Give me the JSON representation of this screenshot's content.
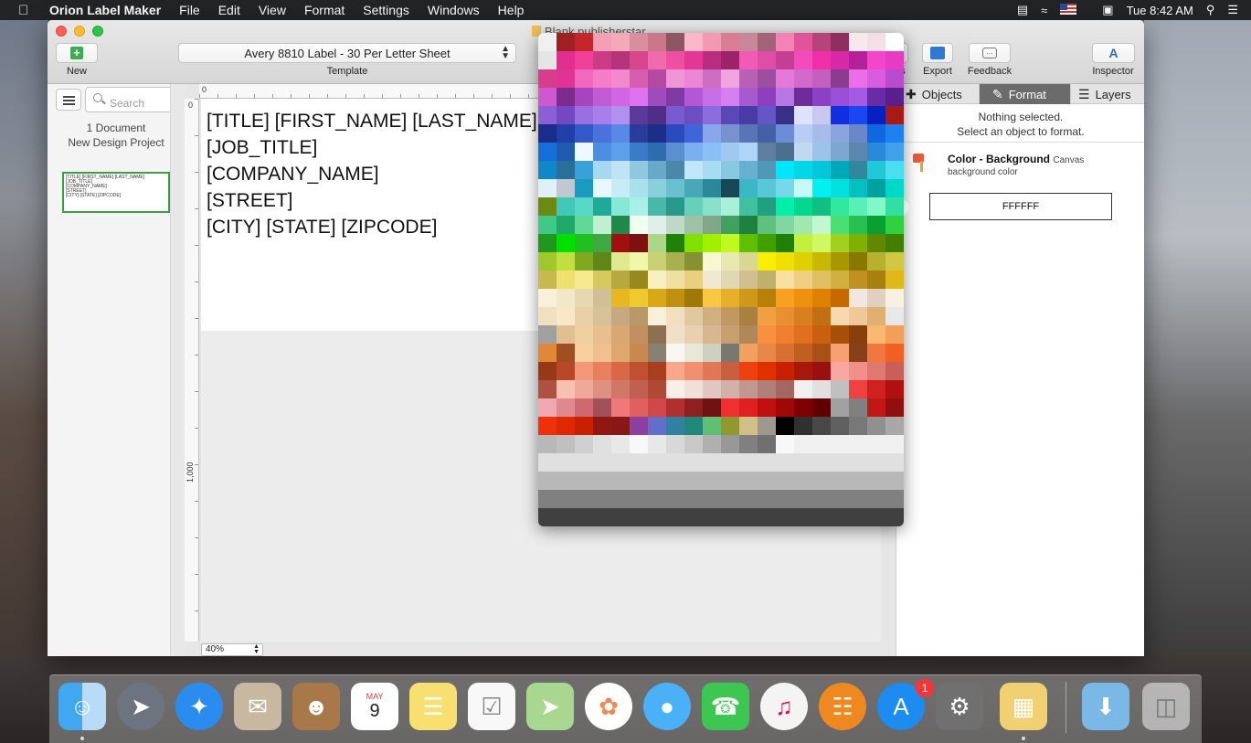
{
  "menubar": {
    "app_name": "Orion Label Maker",
    "items": [
      "File",
      "Edit",
      "View",
      "Format",
      "Settings",
      "Windows",
      "Help"
    ],
    "clock": "Tue 8:42 AM"
  },
  "window": {
    "title": "Blank.publisherstar"
  },
  "toolbar": {
    "new_label": "New",
    "template_value": "Avery 8810 Label - 30 Per Letter Sheet",
    "template_label": "Template",
    "partial_label": "s",
    "export_label": "Export",
    "feedback_label": "Feedback",
    "inspector_label": "Inspector"
  },
  "sidebar": {
    "search_placeholder": "Search",
    "doc_count": "1 Document",
    "project_name": "New Design Project",
    "thumb_lines": [
      "[TITLE] [FIRST_NAME] [LAST_NAME]",
      "[JOB_TITLE]",
      "[COMPANY_NAME]",
      "[STREET]",
      "[CITY] [STATE] [ZIPCODE]"
    ]
  },
  "canvas": {
    "ruler_h_zero": "0",
    "ruler_v_zero": "0",
    "ruler_v_1000": "1,000",
    "zoom": "40%",
    "lines": [
      "[TITLE] [FIRST_NAME] [LAST_NAME]",
      "[JOB_TITLE]",
      "[COMPANY_NAME]",
      "[STREET]",
      "[CITY] [STATE] [ZIPCODE]"
    ]
  },
  "inspector": {
    "tabs": [
      "Objects",
      "Format",
      "Layers"
    ],
    "active_tab": "Format",
    "no_selection_1": "Nothing selected.",
    "no_selection_2": "Select an object to format.",
    "color_title": "Color - Background",
    "color_scope": "Canvas",
    "color_desc": "background color",
    "hex_value": "FFFFFF"
  },
  "dock": {
    "calendar_month": "MAY",
    "calendar_day": "9",
    "appstore_badge": "1",
    "icons": [
      "finder-icon",
      "launchpad-icon",
      "safari-icon",
      "mail-icon",
      "contacts-icon",
      "calendar-icon",
      "notes-icon",
      "reminders-icon",
      "maps-icon",
      "photos-icon",
      "messages-icon",
      "facetime-icon",
      "itunes-icon",
      "ibooks-icon",
      "app-store-icon",
      "system-preferences-icon",
      "label-maker-icon",
      "downloads-folder-icon",
      "trash-icon"
    ]
  },
  "palette": {
    "rows": [
      [
        "#f0f0f0",
        "#a01f22",
        "#c5262c",
        "#f3a0b6",
        "#f5a9b8",
        "#d98d9d",
        "#c8788a",
        "#8e5662",
        "#f9b7c8",
        "#f29ab1",
        "#d97d96",
        "#c7889a",
        "#a36278",
        "#f582b4",
        "#e0559a",
        "#b54479",
        "#8f2e5f",
        "#f5e9ee",
        "#f2e0e6",
        "#fff"
      ],
      [
        "#e5e5e5",
        "#e22e8e",
        "#f0409a",
        "#cc3b88",
        "#b5357a",
        "#d6478d",
        "#f06aac",
        "#f04fa1",
        "#e23797",
        "#b92d7e",
        "#9c2269",
        "#f25bb3",
        "#de4ea8",
        "#c53e93",
        "#f34bba",
        "#f02fa8",
        "#d728a8",
        "#b51f98",
        "#f346c9",
        "#e83bc4"
      ],
      [
        "#d93c8d",
        "#dd3496",
        "#f068c0",
        "#f57cc7",
        "#f389cc",
        "#d65eb1",
        "#b548a0",
        "#f096d8",
        "#ea86d3",
        "#cc6fc1",
        "#f0a4e0",
        "#b860b4",
        "#9c4ea1",
        "#e579d9",
        "#d26acb",
        "#c25fbf",
        "#8a3d8f",
        "#ea6fe7",
        "#d85ce0",
        "#b84ccd"
      ],
      [
        "#ce58cf",
        "#7b2d8e",
        "#a844c0",
        "#c25ad6",
        "#d165e4",
        "#de72f0",
        "#9d4bbd",
        "#7e3aa2",
        "#b457d7",
        "#c76de6",
        "#d77ff0",
        "#a65ad0",
        "#8e3fbf",
        "#b877e0",
        "#6e2c9a",
        "#8a42c5",
        "#9b4fd8",
        "#a35be6",
        "#6a2ca5",
        "#5a1f8f"
      ],
      [
        "#8d5fd6",
        "#7448c2",
        "#9a6fe0",
        "#a87fe8",
        "#b38ff0",
        "#5c3a9c",
        "#4f2e8a",
        "#7a5ad0",
        "#6c4dc2",
        "#8a6cdc",
        "#5b48b8",
        "#4a3aa5",
        "#6556c8",
        "#3a2f88",
        "#e0e0ff",
        "#c8c8f0",
        "#1030e0",
        "#1848f0",
        "#0820c0",
        "#a81a14"
      ],
      [
        "#1a2d8a",
        "#2040a8",
        "#3358c8",
        "#4a72dc",
        "#5a88e8",
        "#2a3c9a",
        "#1c2e88",
        "#2c4ac0",
        "#3e66d8",
        "#8aa6e8",
        "#7892d0",
        "#5a74b8",
        "#4660a8",
        "#6c8cd8",
        "#b8ccf5",
        "#a8bcea",
        "#8aa4dc",
        "#6a88c8",
        "#1068e0",
        "#2080f0"
      ],
      [
        "#1470d8",
        "#1f5cb0",
        "#f0f8ff",
        "#4c8ee0",
        "#5da0ec",
        "#3a7cc8",
        "#2e6cb0",
        "#5a90d0",
        "#7ab0f0",
        "#8ac0f8",
        "#a0c8f0",
        "#b0d4f8",
        "#5e7ea0",
        "#4e6e90",
        "#c0d8f0",
        "#9cc4e8",
        "#7ca8d0",
        "#5c88b0",
        "#2a8ad8",
        "#40a0ec"
      ],
      [
        "#0e88c8",
        "#2a6e9a",
        "#3aa0d8",
        "#a8d8f0",
        "#c0e4f5",
        "#90c8e0",
        "#6aa8c8",
        "#4a88a8",
        "#c0e8f8",
        "#a8dcf0",
        "#88c8e0",
        "#68b0d0",
        "#5098b8",
        "#00e8f8",
        "#00d8e8",
        "#00c8d8",
        "#00a8b8",
        "#308898",
        "#20c8d8",
        "#48e0f0"
      ],
      [
        "#e0f0f8",
        "#c0c8d0",
        "#1a9ac0",
        "#e8f8ff",
        "#c8ecf5",
        "#a8e0ec",
        "#88d0e0",
        "#68c0d0",
        "#48a8b8",
        "#2a8898",
        "#184858",
        "#3ab8c8",
        "#58c8d8",
        "#78d8e8",
        "#c8f8f8",
        "#00f0f0",
        "#00e0e0",
        "#00c0c0",
        "#00a0a0",
        "#00d8c8"
      ],
      [
        "#6a8a10",
        "#40c8b8",
        "#58d8c8",
        "#20a898",
        "#88e8d8",
        "#a8f0e8",
        "#48b8a8",
        "#28988a",
        "#68d0b8",
        "#88e0c8",
        "#a8f0d8",
        "#40c0a0",
        "#20a080",
        "#00f0a8",
        "#00d890",
        "#10c080",
        "#30e8a0",
        "#58f0b8",
        "#80f8c8",
        "#30e0a0"
      ],
      [
        "#40c888",
        "#20a868",
        "#60d898",
        "#c0f0d0",
        "#208848",
        "#f0fff0",
        "#e0f0e8",
        "#c0d8c8",
        "#a0c0a8",
        "#80a888",
        "#40a060",
        "#208040",
        "#60c080",
        "#80d8a0",
        "#a0e8b0",
        "#c0f8d0",
        "#48e070",
        "#28c050",
        "#08a030",
        "#30d040"
      ],
      [
        "#209820",
        "#00e000",
        "#20c020",
        "#40a840",
        "#a01010",
        "#801010",
        "#a8d888",
        "#208008",
        "#80e000",
        "#a0f000",
        "#c0f820",
        "#60c000",
        "#40a000",
        "#208000",
        "#c0f040",
        "#d0f860",
        "#a0d020",
        "#80b000",
        "#608800",
        "#408000"
      ],
      [
        "#a0c828",
        "#c0e040",
        "#80a820",
        "#608818",
        "#e0e890",
        "#f0f8a8",
        "#c8d070",
        "#a8b050",
        "#889030",
        "#f8f8d0",
        "#e8e8b0",
        "#d8d890",
        "#f8f000",
        "#f0e000",
        "#e0d000",
        "#c8b800",
        "#a89800",
        "#887800",
        "#b8b030",
        "#d0c840"
      ],
      [
        "#c8b850",
        "#f0e070",
        "#f8e890",
        "#d8c860",
        "#b8a840",
        "#988820",
        "#f8f0c0",
        "#f0e0a0",
        "#e8d080",
        "#f0e8d0",
        "#e0d8b0",
        "#d0c090",
        "#c0b070",
        "#f8e0a0",
        "#f0d080",
        "#e0c060",
        "#d0b040",
        "#c09020",
        "#a88010",
        "#e0b818"
      ],
      [
        "#f8f0d8",
        "#f0e8c8",
        "#e8d8b0",
        "#d0c098",
        "#e8b820",
        "#f0c830",
        "#d8a818",
        "#c09010",
        "#a07808",
        "#f8c840",
        "#e8b028",
        "#d09818",
        "#b88008",
        "#f8a020",
        "#f09010",
        "#e08000",
        "#c86800",
        "#f0e8e0",
        "#e0d0c0",
        "#f8f0e0"
      ],
      [
        "#f0e0c0",
        "#f8e8c8",
        "#e8d0a8",
        "#d8c098",
        "#c8a880",
        "#b89868",
        "#f8f0d8",
        "#f0e0c0",
        "#e0c8a0",
        "#d0b080",
        "#c09860",
        "#a88040",
        "#f0a040",
        "#e89030",
        "#d88020",
        "#c07010",
        "#f8d8b0",
        "#f0c898",
        "#e0b070",
        "#e8e8e8"
      ],
      [
        "#a0a0a0",
        "#e0c090",
        "#f0d0a0",
        "#e8c090",
        "#d8a870",
        "#c09060",
        "#8c7050",
        "#f0e0c8",
        "#e8d0b0",
        "#d8b890",
        "#c8a070",
        "#b08858",
        "#f89040",
        "#f08030",
        "#e07020",
        "#c86010",
        "#a85008",
        "#884008",
        "#f8b870",
        "#f0a058"
      ],
      [
        "#e08838",
        "#a05020",
        "#f8d0a0",
        "#f0c090",
        "#e0a870",
        "#c88850",
        "#888070",
        "#f8f8f0",
        "#e8e8d8",
        "#d0d0c0",
        "#787870",
        "#f0a060",
        "#e88848",
        "#d87030",
        "#c06020",
        "#a85018",
        "#f8a070",
        "#884018",
        "#f07840",
        "#f06020"
      ],
      [
        "#983818",
        "#b84828",
        "#f09878",
        "#e88060",
        "#d86848",
        "#c05030",
        "#a84020",
        "#f8a888",
        "#f09070",
        "#e07858",
        "#c86040",
        "#f04010",
        "#e03000",
        "#c82000",
        "#a81808",
        "#981010",
        "#f8a8a0",
        "#f09088",
        "#e07870",
        "#c86058"
      ],
      [
        "#b05040",
        "#f8c0b0",
        "#f0a898",
        "#e09080",
        "#d07868",
        "#c06050",
        "#b04838",
        "#f8f0e8",
        "#f0e0d8",
        "#e0c8c0",
        "#d0b0a8",
        "#c09890",
        "#b08078",
        "#a06860",
        "#f0f0f0",
        "#e0e0e0",
        "#c0c0c0",
        "#f04040",
        "#d02020",
        "#b01010"
      ],
      [
        "#f0a8b0",
        "#e08890",
        "#d06870",
        "#a05058",
        "#f07878",
        "#e06060",
        "#d04848",
        "#b03030",
        "#902020",
        "#701010",
        "#f03030",
        "#e02020",
        "#c01010",
        "#a00808",
        "#800000",
        "#600000",
        "#a0a0a0",
        "#808080",
        "#c01818",
        "#901010"
      ],
      [
        "#f03008",
        "#e02800",
        "#c82000",
        "#901810",
        "#881818",
        "#8c40a0",
        "#6070c8",
        "#3080a0",
        "#208878",
        "#60c070",
        "#909830",
        "#d0c088",
        "#a09890",
        "#000000",
        "#303030",
        "#484848",
        "#606060",
        "#787878",
        "#909090",
        "#a8a8a8"
      ],
      [
        "#b8b8b8",
        "#c0c0c0",
        "#d0d0d0",
        "#e0e0e0",
        "#e8e8e8",
        "#f8f8f8",
        "#e8e8e8",
        "#d8d8d8",
        "#c8c8c8",
        "#b0b0b0",
        "#989898",
        "#808080",
        "#707070",
        "#f8f8f8",
        "#f0f0f0",
        "#f0f0f0",
        "#f0f0f0",
        "#f0f0f0",
        "#f0f0f0",
        "#f0f0f0"
      ],
      [
        "#e0e0e0",
        "#e0e0e0",
        "#e0e0e0",
        "#e0e0e0",
        "#e0e0e0",
        "#e0e0e0",
        "#e0e0e0",
        "#e0e0e0",
        "#e0e0e0",
        "#e0e0e0",
        "#e0e0e0",
        "#e0e0e0",
        "#e0e0e0",
        "#e0e0e0",
        "#e0e0e0",
        "#e0e0e0",
        "#e0e0e0",
        "#e0e0e0",
        "#e0e0e0",
        "#e0e0e0"
      ],
      [
        "#b8b8b8",
        "#b8b8b8",
        "#b8b8b8",
        "#b8b8b8",
        "#b8b8b8",
        "#b8b8b8",
        "#b8b8b8",
        "#b8b8b8",
        "#b8b8b8",
        "#b8b8b8",
        "#b8b8b8",
        "#b8b8b8",
        "#b8b8b8",
        "#b8b8b8",
        "#b8b8b8",
        "#b8b8b8",
        "#b8b8b8",
        "#b8b8b8",
        "#b8b8b8",
        "#b8b8b8"
      ],
      [
        "#808080",
        "#808080",
        "#808080",
        "#808080",
        "#808080",
        "#808080",
        "#808080",
        "#808080",
        "#808080",
        "#808080",
        "#808080",
        "#808080",
        "#808080",
        "#808080",
        "#808080",
        "#808080",
        "#808080",
        "#808080",
        "#808080",
        "#808080"
      ],
      [
        "#404040",
        "#404040",
        "#404040",
        "#404040",
        "#404040",
        "#404040",
        "#404040",
        "#404040",
        "#404040",
        "#404040",
        "#404040",
        "#404040",
        "#404040",
        "#404040",
        "#404040",
        "#404040",
        "#404040",
        "#404040",
        "#404040",
        "#404040"
      ]
    ]
  }
}
